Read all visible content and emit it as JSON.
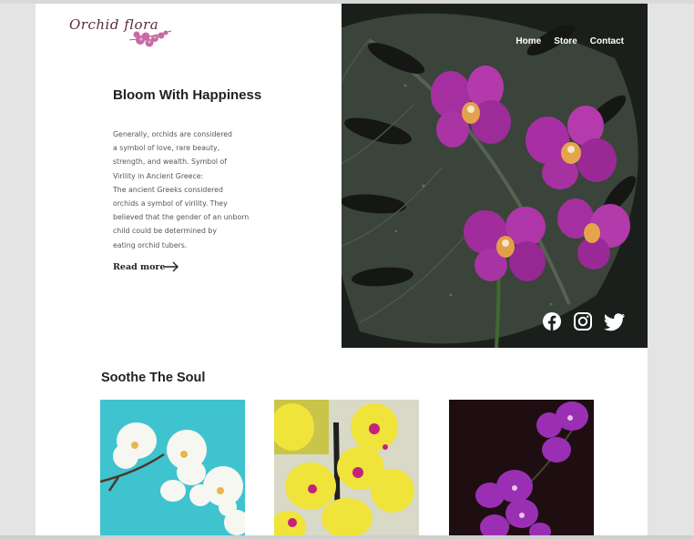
{
  "brand": {
    "logo_text": "Orchid flora"
  },
  "nav": {
    "items": [
      {
        "label": "Home"
      },
      {
        "label": "Store"
      },
      {
        "label": "Contact"
      }
    ]
  },
  "intro": {
    "headline": "Bloom With Happiness",
    "lines": [
      "Generally, orchids are considered",
      "a symbol of love, rare beauty,",
      "strength, and wealth. Symbol of",
      "Virility in Ancient Greece:",
      "The ancient Greeks considered",
      "orchids a symbol of virility. They",
      "believed that the gender of an unborn",
      "child could be determined by",
      "eating orchid tubers."
    ],
    "read_more": "Read more"
  },
  "social": {
    "icons": [
      "facebook-icon",
      "instagram-icon",
      "twitter-icon"
    ]
  },
  "gallery": {
    "title": "Soothe The Soul",
    "cards": [
      {
        "name": "white-orchid",
        "bg": "#3fc3cf",
        "petal": "#f7f7f2",
        "center": "#e9b64a"
      },
      {
        "name": "yellow-orchid",
        "bg": "#d9d9c8",
        "petal": "#f0e33a",
        "center": "#c2227c"
      },
      {
        "name": "purple-orchid",
        "bg": "#1e0e12",
        "petal": "#9b2fb3",
        "center": "#e7c3e9"
      }
    ]
  },
  "colors": {
    "accent": "#a13fa6",
    "leaf": "#3c4a3c",
    "text": "#222222"
  }
}
